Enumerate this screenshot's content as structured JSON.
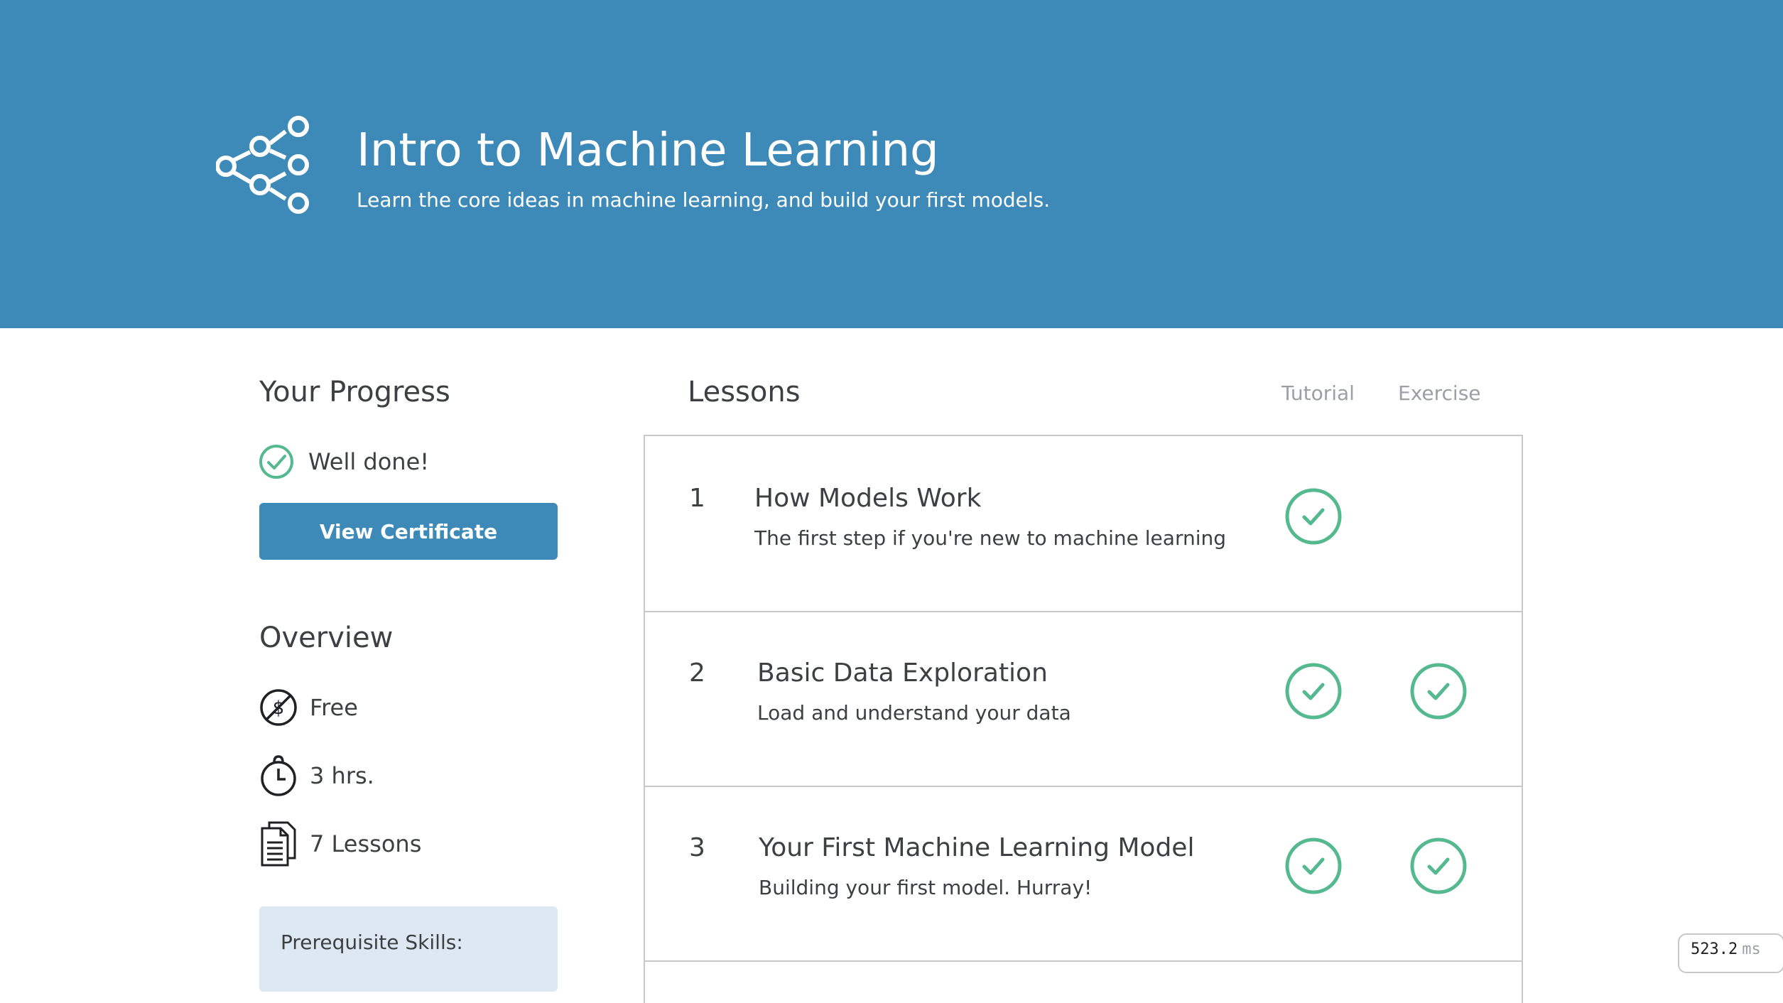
{
  "header": {
    "title": "Intro to Machine Learning",
    "subtitle": "Learn the core ideas in machine learning, and build your first models.",
    "icon": "network-nodes-icon",
    "background_color": "#3d8ab9"
  },
  "progress": {
    "heading": "Your Progress",
    "status_text": "Well done!",
    "status_icon": "check-circle-icon",
    "button_label": "View Certificate"
  },
  "overview": {
    "heading": "Overview",
    "items": [
      {
        "icon": "no-cost-icon",
        "label": "Free"
      },
      {
        "icon": "stopwatch-icon",
        "label": "3 hrs."
      },
      {
        "icon": "document-icon",
        "label": "7 Lessons"
      }
    ],
    "prerequisite_label": "Prerequisite Skills:"
  },
  "lessons": {
    "heading": "Lessons",
    "column_tutorial": "Tutorial",
    "column_exercise": "Exercise",
    "items": [
      {
        "number": "1",
        "title": "How Models Work",
        "description": "The first step if you're new to machine learning",
        "tutorial_done": true,
        "exercise_done": false
      },
      {
        "number": "2",
        "title": "Basic Data Exploration",
        "description": "Load and understand your data",
        "tutorial_done": true,
        "exercise_done": true
      },
      {
        "number": "3",
        "title": "Your First Machine Learning Model",
        "description": "Building your first model. Hurray!",
        "tutorial_done": true,
        "exercise_done": true
      }
    ]
  },
  "timing": {
    "value": "523.2",
    "unit": "ms"
  },
  "colors": {
    "accent": "#3d8ab9",
    "success": "#55b990",
    "prerequisite_bg": "#dde8f2"
  }
}
